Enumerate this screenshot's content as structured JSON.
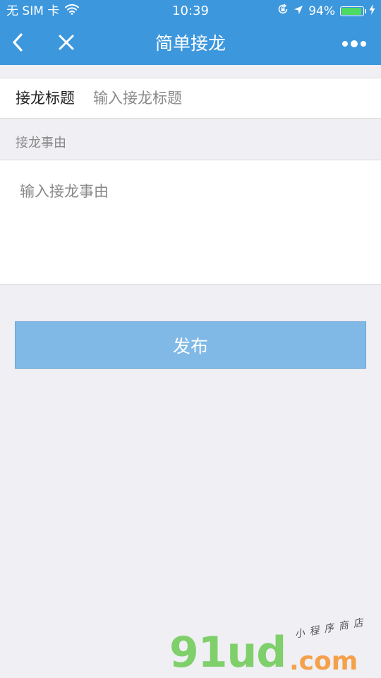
{
  "status_bar": {
    "carrier": "无 SIM 卡",
    "time": "10:39",
    "battery_percent": "94%",
    "battery_level": 0.94,
    "icons": [
      "wifi-icon",
      "orientation-lock-icon",
      "location-arrow-icon",
      "battery-icon",
      "charging-bolt-icon"
    ]
  },
  "nav": {
    "title": "简单接龙",
    "back_icon": "chevron-left-icon",
    "close_icon": "close-icon",
    "more_icon": "more-dots-icon"
  },
  "form": {
    "title_label": "接龙标题",
    "title_placeholder": "输入接龙标题",
    "title_value": "",
    "reason_section_label": "接龙事由",
    "reason_placeholder": "输入接龙事由",
    "reason_value": ""
  },
  "actions": {
    "publish_label": "发布"
  },
  "watermark": {
    "main": "91ud",
    "domain": ".com",
    "subtitle": "小程序商店"
  },
  "colors": {
    "nav_bg": "#3c97dd",
    "page_bg": "#efeff4",
    "publish_bg": "#80b9e5",
    "battery_fill": "#4cd964",
    "watermark_green": "#7fcf6a",
    "watermark_orange": "#f5a04a"
  }
}
